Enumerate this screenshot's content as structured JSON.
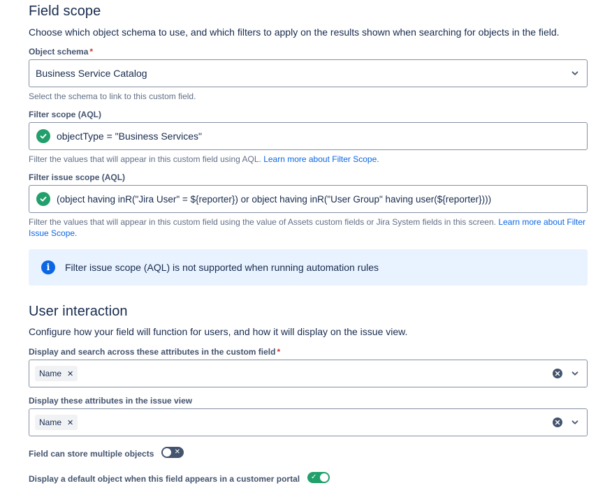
{
  "field_scope": {
    "title": "Field scope",
    "description": "Choose which object schema to use, and which filters to apply on the results shown when searching for objects in the field.",
    "object_schema": {
      "label": "Object schema",
      "required_mark": "*",
      "value": "Business Service Catalog",
      "help": "Select the schema to link to this custom field."
    },
    "filter_scope": {
      "label": "Filter scope (AQL)",
      "value": "objectType = \"Business Services\"",
      "help": "Filter the values that will appear in this custom field using AQL.",
      "link": "Learn more about Filter Scope."
    },
    "filter_issue_scope": {
      "label": "Filter issue scope (AQL)",
      "value": "(object having inR(\"Jira User\" = ${reporter}) or object having inR(\"User Group\" having user(${reporter})))",
      "help": "Filter the values that will appear in this custom field using the value of Assets custom fields or Jira System fields in this screen.",
      "link": "Learn more about Filter Issue Scope."
    },
    "info_message": "Filter issue scope (AQL) is not supported when running automation rules"
  },
  "user_interaction": {
    "title": "User interaction",
    "description": "Configure how your field will function for users, and how it will display on the issue view.",
    "search_attributes": {
      "label": "Display and search across these attributes in the custom field",
      "required_mark": "*",
      "tags": [
        "Name"
      ]
    },
    "issue_view_attributes": {
      "label": "Display these attributes in the issue view",
      "tags": [
        "Name"
      ]
    },
    "multiple_objects": {
      "label": "Field can store multiple objects",
      "enabled": false
    },
    "default_object": {
      "label": "Display a default object when this field appears in a customer portal",
      "enabled": true
    }
  },
  "colors": {
    "success": "#22a06b",
    "info_bg": "#e9f2ff",
    "info_icon": "#0c66e4",
    "link": "#0c66e4",
    "required": "#c9372c"
  }
}
